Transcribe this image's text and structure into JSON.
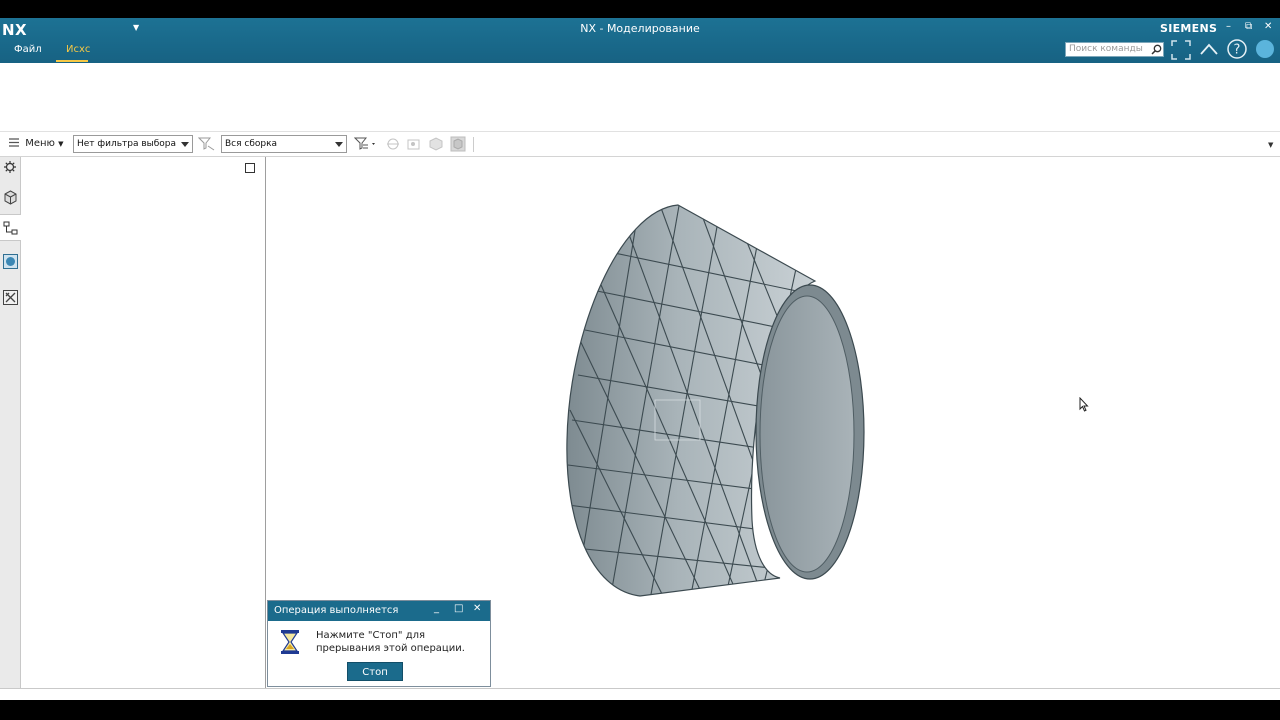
{
  "app": {
    "logo": "NX",
    "window_title": "NX - Моделирование",
    "brand": "SIEMENS"
  },
  "menu": {
    "file_label": "Файл",
    "home_tab_label": "Исхс"
  },
  "command_search": {
    "placeholder": "Поиск команды"
  },
  "selection_bar": {
    "menu_label": "Меню",
    "filter_value": "Нет фильтра выбора",
    "scope_value": "Вся сборка"
  },
  "dialog": {
    "title": "Операция выполняется",
    "message": "Нажмите \"Стоп\" для прерывания этой операции.",
    "stop_label": "Стоп"
  },
  "colors": {
    "titlebar": "#1b6b8c",
    "active_tab": "#f6c845",
    "model": "#8f9ca3"
  },
  "icons": [
    "quick-access-caret-icon",
    "minimize-icon",
    "restore-icon",
    "close-icon",
    "search-icon",
    "fullscreen-icon",
    "collapse-ribbon-icon",
    "help-icon",
    "user-icon",
    "hamburger-icon",
    "filter-icon",
    "select-tools-icon",
    "settings-icon",
    "part-icon",
    "assembly-navigator-icon",
    "web-icon",
    "tools-icon",
    "pin-icon",
    "hourglass-icon",
    "cursor-icon"
  ]
}
